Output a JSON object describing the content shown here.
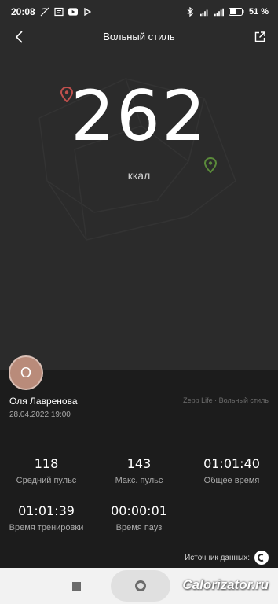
{
  "status_bar": {
    "time": "20:08",
    "battery": "51 %",
    "icons": [
      "no-call-icon",
      "message-icon",
      "youtube-icon",
      "play-icon",
      "bluetooth-icon",
      "signal-icon",
      "wifi-icon",
      "battery-icon"
    ]
  },
  "header": {
    "title": "Вольный стиль",
    "back_icon": "chevron-left-icon",
    "share_icon": "share-icon"
  },
  "summary": {
    "value": "262",
    "unit": "ккал"
  },
  "profile": {
    "avatar_letter": "О",
    "name": "Оля Лавренова",
    "datetime": "28.04.2022 19:00",
    "app_source": "Zepp Life · Вольный стиль"
  },
  "stats": [
    {
      "value": "118",
      "label": "Средний пульс"
    },
    {
      "value": "143",
      "label": "Макс. пульс"
    },
    {
      "value": "01:01:40",
      "label": "Общее время"
    },
    {
      "value": "01:01:39",
      "label": "Время тренировки"
    },
    {
      "value": "00:00:01",
      "label": "Время пауз"
    }
  ],
  "data_source": {
    "label": "Источник данных:"
  },
  "watermark": "Calorizator.ru",
  "colors": {
    "background": "#1c1c1c",
    "map": "#2b2b2b",
    "pin_start": "#c0504d",
    "pin_end": "#5a8a3a"
  }
}
